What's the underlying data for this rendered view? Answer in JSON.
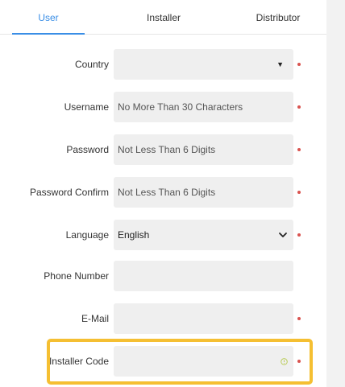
{
  "tabs": [
    {
      "label": "User",
      "active": true
    },
    {
      "label": "Installer",
      "active": false
    },
    {
      "label": "Distributor",
      "active": false
    }
  ],
  "form": {
    "country": {
      "label": "Country",
      "value": "",
      "dropdown_icon": "caret-down-icon",
      "required": true
    },
    "username": {
      "label": "Username",
      "placeholder": "No More Than 30 Characters",
      "required": true
    },
    "password": {
      "label": "Password",
      "placeholder": "Not Less Than 6 Digits",
      "required": true
    },
    "password_confirm": {
      "label": "Password Confirm",
      "placeholder": "Not Less Than 6 Digits",
      "required": true
    },
    "language": {
      "label": "Language",
      "value": "English",
      "dropdown_icon": "chevron-down-icon",
      "required": true
    },
    "phone": {
      "label": "Phone Number",
      "placeholder": "",
      "required": false
    },
    "email": {
      "label": "E-Mail",
      "placeholder": "",
      "required": true
    },
    "installer_code": {
      "label": "Installer Code",
      "placeholder": "",
      "hint_icon": "info-circle-icon",
      "required": true,
      "highlighted": true
    }
  },
  "colors": {
    "accent": "#3a8ee6",
    "required_dot": "#d9534f",
    "highlight": "#f5bf32",
    "field_bg": "#efefef",
    "hint_icon": "#b5c94a"
  }
}
